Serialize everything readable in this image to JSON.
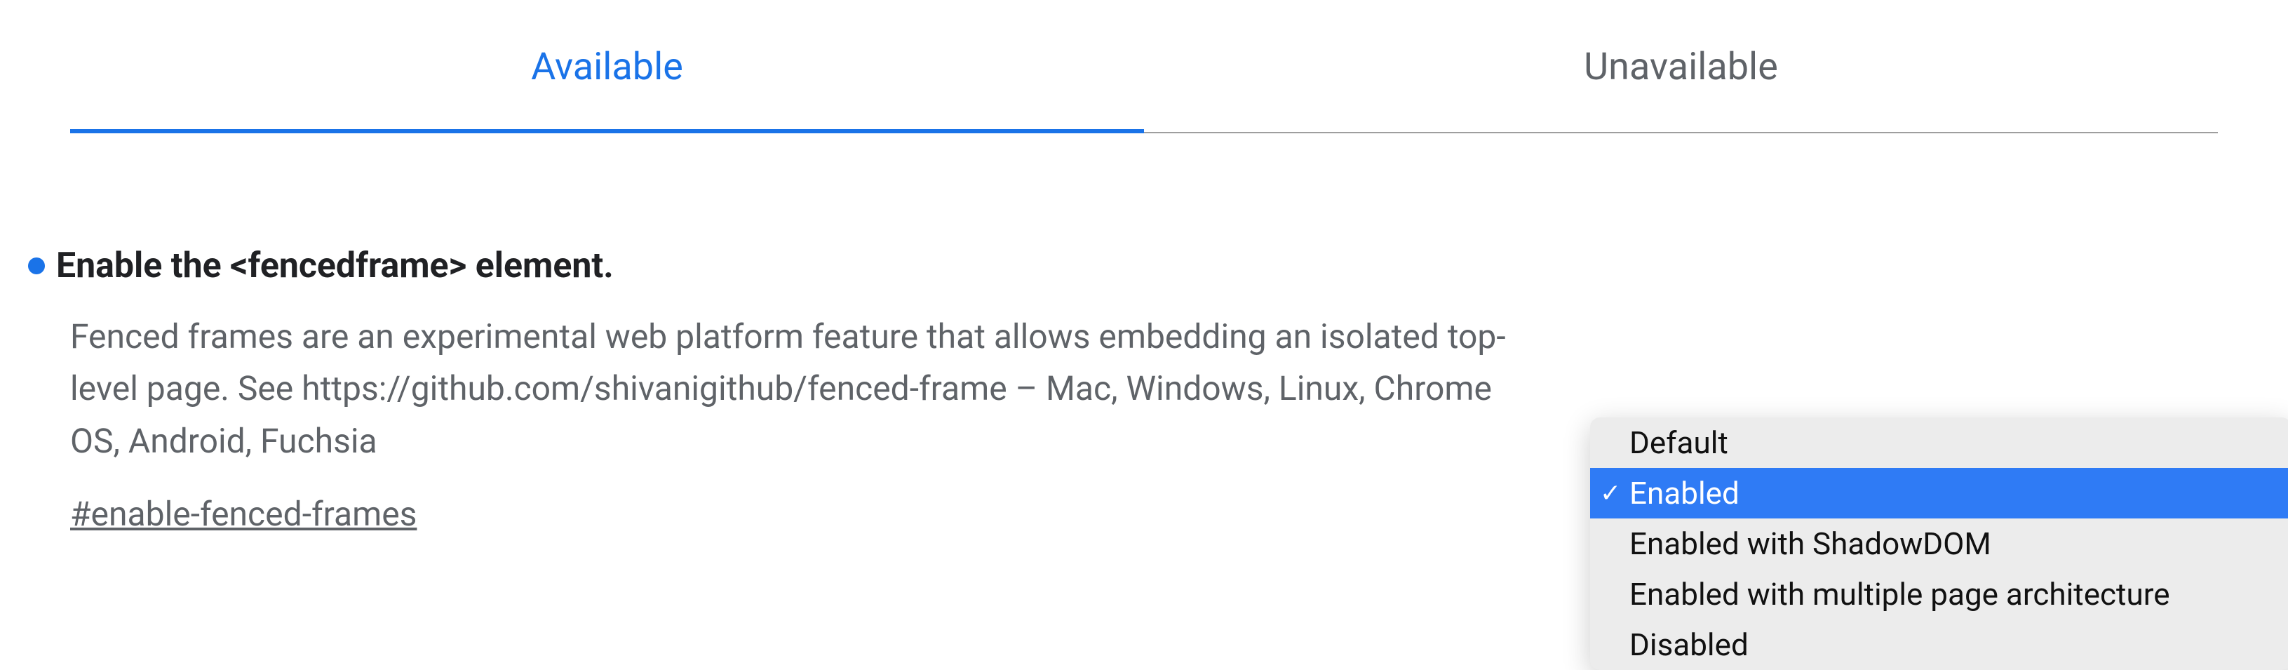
{
  "tabs": {
    "available": "Available",
    "unavailable": "Unavailable"
  },
  "flag": {
    "title": "Enable the <fencedframe> element.",
    "description": "Fenced frames are an experimental web platform feature that allows embedding an isolated top-level page. See https://github.com/shivanigithub/fenced-frame – Mac, Windows, Linux, Chrome OS, Android, Fuchsia",
    "hash": "#enable-fenced-frames"
  },
  "dropdown": {
    "options": [
      "Default",
      "Enabled",
      "Enabled with ShadowDOM",
      "Enabled with multiple page architecture",
      "Disabled"
    ],
    "selected": "Enabled"
  }
}
